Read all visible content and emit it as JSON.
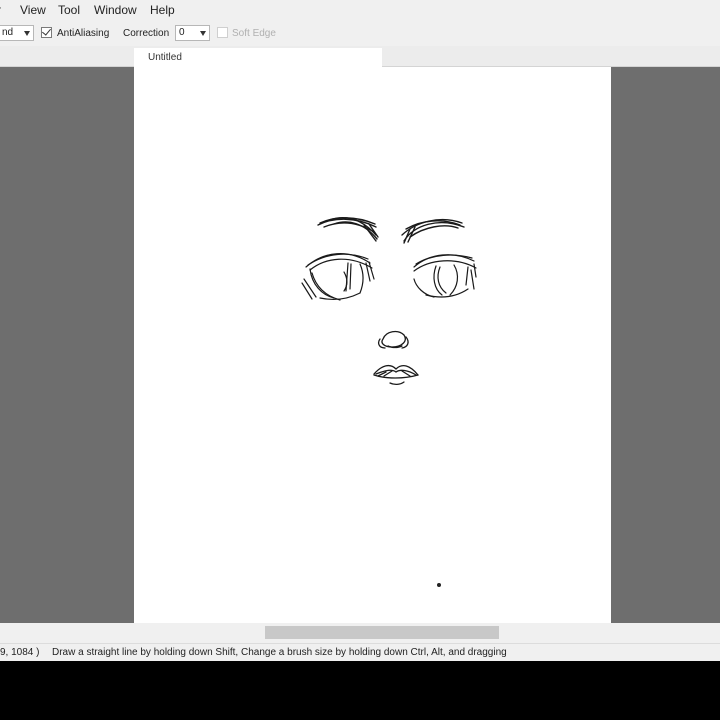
{
  "menu": {
    "items": [
      "r",
      "View",
      "Tool",
      "Window",
      "Help"
    ]
  },
  "toolbar": {
    "brush_mode_value": "nd",
    "antialiasing_label": "AntiAliasing",
    "antialiasing_checked": true,
    "correction_label": "Correction",
    "correction_value": "0",
    "soft_edge_label": "Soft Edge",
    "soft_edge_checked": false
  },
  "tabs": [
    {
      "label": "Untitled",
      "active": true
    }
  ],
  "canvas": {
    "drawing_subject": "line-art face sketch (eyebrows, eyes, nose, lips)",
    "stroke_color": "#1a1a1a"
  },
  "status": {
    "coords": "9, 1084 )",
    "hint": "Draw a straight line by holding down Shift, Change a brush size by holding down Ctrl, Alt, and dragging"
  },
  "colors": {
    "workspace_bg": "#6e6e6e",
    "canvas_bg": "#ffffff",
    "chrome_bg": "#f0f0f0"
  }
}
